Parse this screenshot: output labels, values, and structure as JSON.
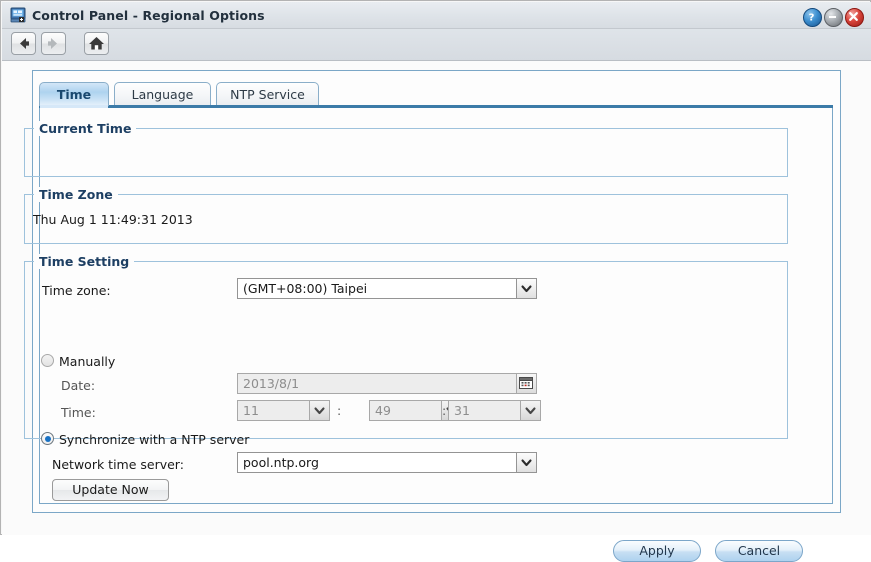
{
  "window": {
    "title": "Control Panel - Regional Options",
    "icon": "control-panel-icon",
    "buttons": {
      "help": "?",
      "minimize": "−",
      "close": "✕"
    }
  },
  "toolbar": {
    "back": "back-arrow-icon",
    "forward": "forward-arrow-icon",
    "home": "home-icon"
  },
  "tabs": [
    {
      "label": "Time",
      "active": true
    },
    {
      "label": "Language",
      "active": false
    },
    {
      "label": "NTP Service",
      "active": false
    }
  ],
  "current_time": {
    "legend": "Current Time",
    "value": "Thu Aug 1 11:49:31 2013"
  },
  "time_zone": {
    "legend": "Time Zone",
    "label": "Time zone:",
    "value": "(GMT+08:00) Taipei"
  },
  "time_setting": {
    "legend": "Time Setting",
    "manually": {
      "label": "Manually",
      "selected": false,
      "date_label": "Date:",
      "date_value": "2013/8/1",
      "time_label": "Time:",
      "hour": "11",
      "minute": "49",
      "second": "31",
      "separator": ":",
      "calendar_icon": "calendar-icon"
    },
    "ntp": {
      "label": "Synchronize with a NTP server",
      "selected": true,
      "server_label": "Network time server:",
      "server_value": "pool.ntp.org",
      "update_button": "Update Now"
    }
  },
  "footer": {
    "apply": "Apply",
    "cancel": "Cancel"
  },
  "colors": {
    "accent": "#3c7ba8",
    "legend_text": "#1d3f63",
    "radio_selected": "#1a72c4",
    "close_button": "#d9453c",
    "help_button": "#3d8fd0"
  }
}
